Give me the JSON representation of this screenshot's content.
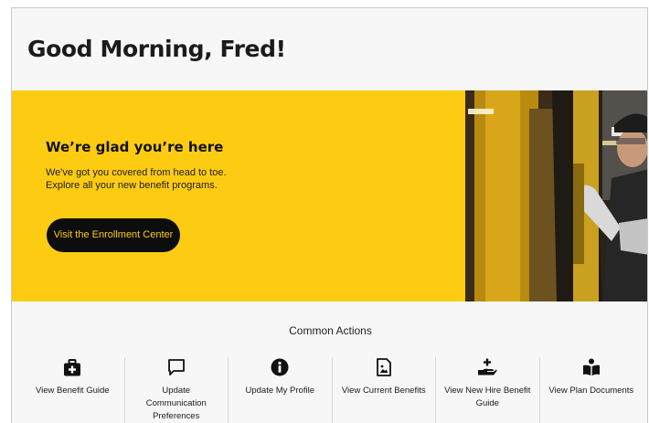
{
  "greeting": "Good Morning, Fred!",
  "hero": {
    "title": "We’re glad you’re here",
    "line1": "We've got you covered from head to toe.",
    "line2": "Explore all your new benefit programs.",
    "cta_label": "Visit the Enrollment Center",
    "background_color": "#fecb13"
  },
  "common_actions": {
    "title": "Common Actions",
    "items": [
      {
        "label": "View Benefit Guide",
        "icon": "first-aid-kit-icon"
      },
      {
        "label": "Update Communication Preferences",
        "icon": "chat-bubble-icon"
      },
      {
        "label": "Update My Profile",
        "icon": "info-icon"
      },
      {
        "label": "View Current Benefits",
        "icon": "document-image-icon"
      },
      {
        "label": "View New Hire Benefit Guide",
        "icon": "hand-plus-icon"
      },
      {
        "label": "View Plan Documents",
        "icon": "person-book-icon"
      }
    ]
  }
}
